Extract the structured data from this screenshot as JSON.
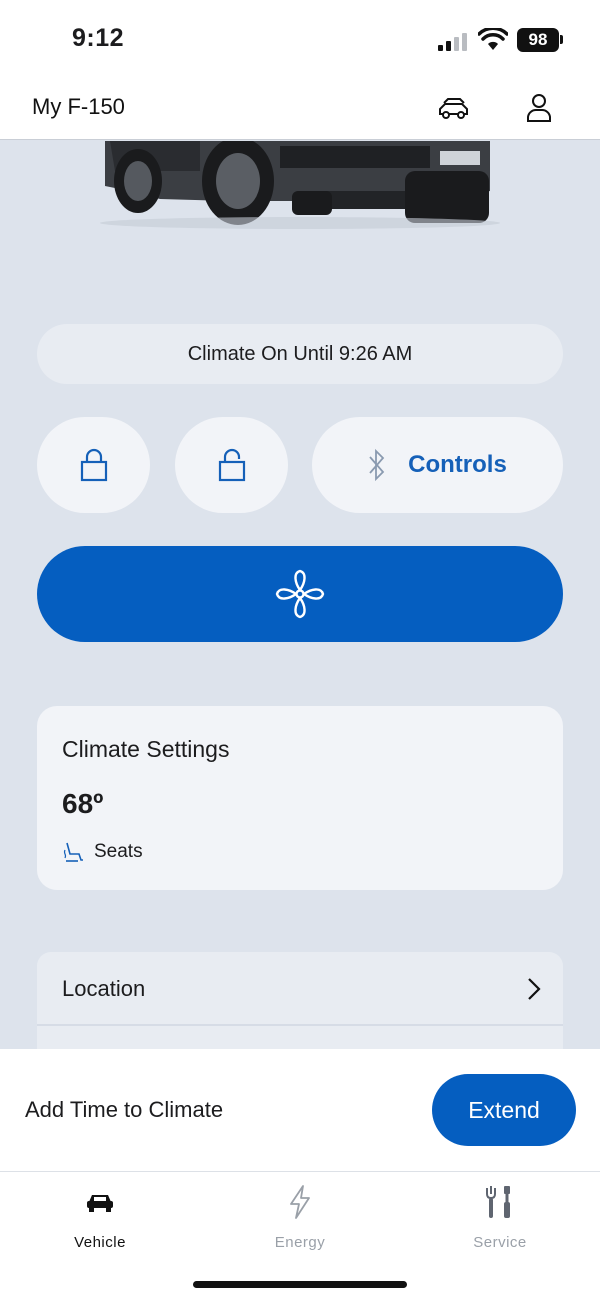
{
  "status_bar": {
    "time": "9:12",
    "battery": "98"
  },
  "header": {
    "title": "My F-150",
    "icons": [
      "vehicles-icon",
      "profile-icon"
    ]
  },
  "climate_status": "Climate On Until 9:26 AM",
  "controls": {
    "lock_icon": "lock-icon",
    "unlock_icon": "unlock-icon",
    "bluetooth_icon": "bluetooth-icon",
    "controls_label": "Controls"
  },
  "fan_button": {
    "icon": "fan-icon"
  },
  "climate_settings": {
    "title": "Climate Settings",
    "temperature": "68º",
    "seats_label": "Seats"
  },
  "list": [
    {
      "label": "Location"
    }
  ],
  "bottom_sheet": {
    "label": "Add Time to Climate",
    "button": "Extend"
  },
  "tabs": [
    {
      "label": "Vehicle",
      "icon": "car-icon",
      "active": true
    },
    {
      "label": "Energy",
      "icon": "lightning-icon",
      "active": false
    },
    {
      "label": "Service",
      "icon": "tools-icon",
      "active": false
    }
  ],
  "colors": {
    "accent": "#055ec0",
    "background": "#dde3ec",
    "link": "#1560b8"
  }
}
